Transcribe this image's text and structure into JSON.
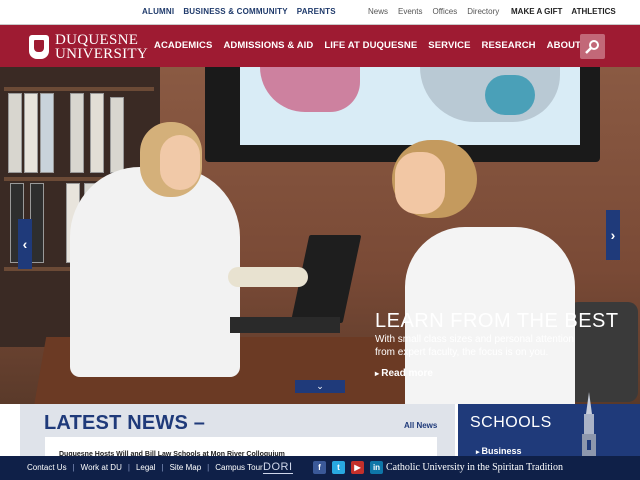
{
  "topbar": {
    "left": [
      "ALUMNI",
      "BUSINESS & COMMUNITY",
      "PARENTS"
    ],
    "mid": [
      "News",
      "Events",
      "Offices",
      "Directory"
    ],
    "right": [
      "MAKE A GIFT",
      "ATHLETICS"
    ]
  },
  "nav": {
    "logo_line1": "DUQUESNE",
    "logo_line2": "UNIVERSITY",
    "items": [
      "ACADEMICS",
      "ADMISSIONS & AID",
      "LIFE AT DUQUESNE",
      "SERVICE",
      "RESEARCH",
      "ABOUT"
    ],
    "search_icon": "search-icon"
  },
  "hero": {
    "title": "LEARN FROM THE BEST",
    "subtitle": "With small class sizes and personal attention from expert faculty, the focus is on you.",
    "more": "Read more",
    "prev_icon": "‹",
    "next_icon": "›",
    "down_icon": "⌄"
  },
  "news": {
    "title": "LATEST NEWS –",
    "all_link": "All News",
    "item": "Duquesne Hosts Will and Bill Law Schools at Mon River Colloquium"
  },
  "schools": {
    "title": "SCHOOLS",
    "item": "Business"
  },
  "footer": {
    "links": [
      "Contact Us",
      "Work at DU",
      "Legal",
      "Site Map",
      "Campus Tour"
    ],
    "dori": "DORI",
    "social": [
      "f",
      "t",
      "▶",
      "in"
    ],
    "tagline": "Catholic University in the Spiritan Tradition"
  },
  "colors": {
    "brand_red": "#9e1b32",
    "brand_blue": "#1f3a7a",
    "footer_navy": "#0f2048"
  }
}
